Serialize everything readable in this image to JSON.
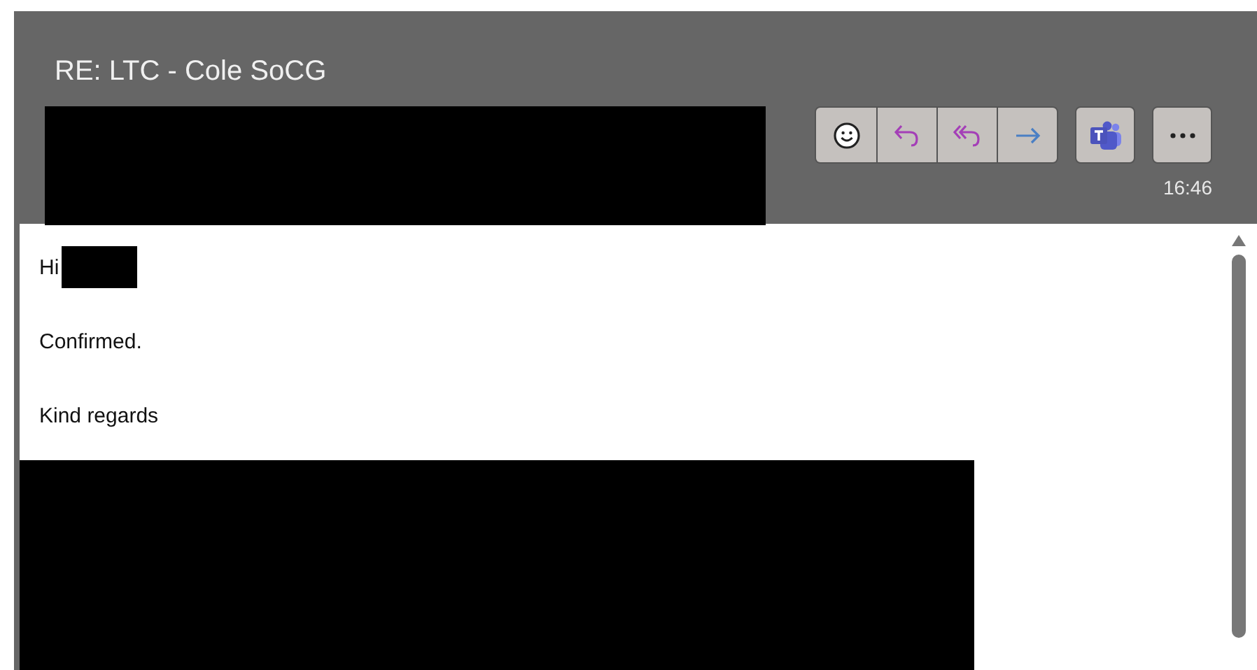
{
  "message": {
    "subject": "RE: LTC - Cole SoCG",
    "time": "16:46"
  },
  "respond_actions": [
    {
      "kind": "react"
    },
    {
      "kind": "reply"
    },
    {
      "kind": "reply-all"
    },
    {
      "kind": "forward"
    }
  ],
  "actions": [
    {
      "kind": "teams"
    },
    {
      "kind": "more"
    }
  ],
  "body": [
    {
      "kind": "greeting",
      "text": "Hi"
    },
    {
      "kind": "paragraph",
      "text": "Confirmed."
    },
    {
      "kind": "paragraph",
      "text": "Kind regards"
    }
  ]
}
